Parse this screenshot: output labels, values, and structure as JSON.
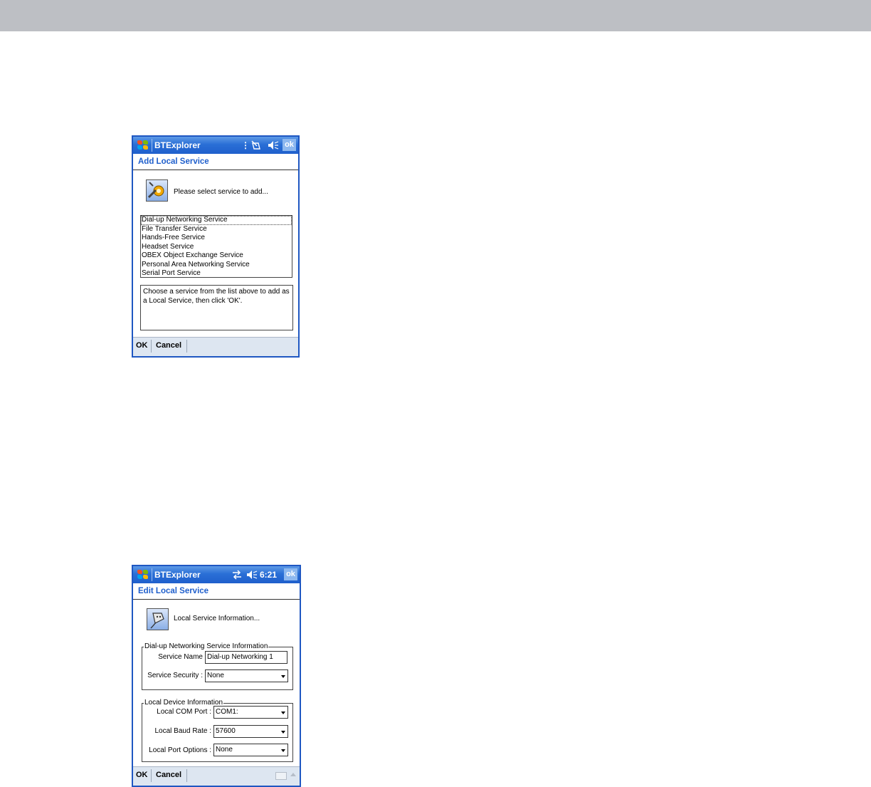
{
  "screen1": {
    "app_title": "BTExplorer",
    "ok_label": "ok",
    "page_title": "Add Local Service",
    "prompt": "Please select service to add...",
    "services": [
      "Dial-up Networking Service",
      "File Transfer Service",
      "Hands-Free Service",
      "Headset Service",
      "OBEX Object Exchange Service",
      "Personal Area Networking Service",
      "Serial Port Service"
    ],
    "selected_index": 0,
    "help_text": "Choose a service from the list above to add as a Local Service, then click 'OK'.",
    "menu": {
      "left": "OK",
      "right": "Cancel"
    }
  },
  "screen2": {
    "app_title": "BTExplorer",
    "clock": "6:21",
    "ok_label": "ok",
    "page_title": "Edit Local Service",
    "prompt": "Local Service Information...",
    "group1": {
      "legend": "Dial-up Networking Service Information",
      "service_name_label": "Service Name",
      "service_name_value": "Dial-up Networking 1",
      "service_security_label": "Service Security :",
      "service_security_value": "None"
    },
    "group2": {
      "legend": "Local Device Information",
      "com_port_label": "Local COM Port :",
      "com_port_value": "COM1:",
      "baud_rate_label": "Local Baud Rate :",
      "baud_rate_value": "57600",
      "port_options_label": "Local Port Options :",
      "port_options_value": "None"
    },
    "menu": {
      "left": "OK",
      "right": "Cancel"
    }
  },
  "icons": {
    "start": "windows-start-icon",
    "antenna": "antenna-icon",
    "no_connection": "no-connection-icon",
    "connectivity": "connectivity-arrows-icon",
    "speaker": "speaker-icon"
  }
}
